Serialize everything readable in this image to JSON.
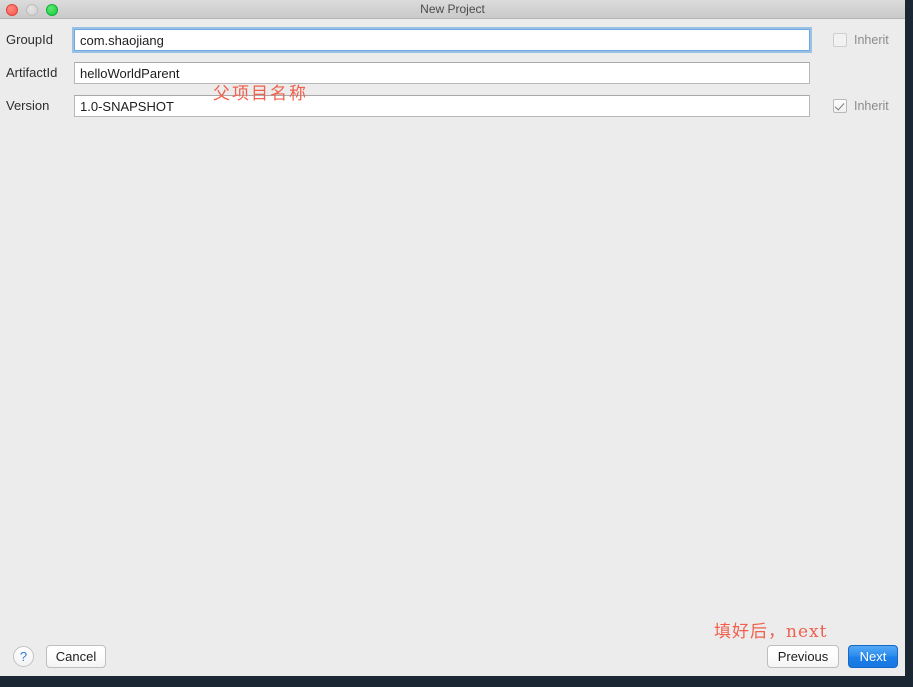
{
  "window": {
    "title": "New Project",
    "traffic_lights": [
      "close",
      "minimize",
      "zoom"
    ]
  },
  "form": {
    "fields": [
      {
        "label": "GroupId",
        "value": "com.shaojiang",
        "focused": true,
        "inherit": {
          "label": "Inherit",
          "checked": false,
          "enabled": false
        }
      },
      {
        "label": "ArtifactId",
        "value": "helloWorldParent",
        "focused": false,
        "inherit": null
      },
      {
        "label": "Version",
        "value": "1.0-SNAPSHOT",
        "focused": false,
        "inherit": {
          "label": "Inherit",
          "checked": true,
          "enabled": true
        }
      }
    ]
  },
  "annotations": [
    {
      "text": "父项目名称",
      "color": "#f0604d"
    },
    {
      "text": "填好后，next",
      "color": "#f0604d"
    }
  ],
  "buttons": {
    "help": "?",
    "cancel": "Cancel",
    "previous": "Previous",
    "next": "Next"
  },
  "colors": {
    "accent": "#2b8cef",
    "annotation": "#f0604d",
    "window_bg": "#ececec",
    "titlebar_bg": "#d2d2d2",
    "desktop_border": "#1b2732"
  }
}
